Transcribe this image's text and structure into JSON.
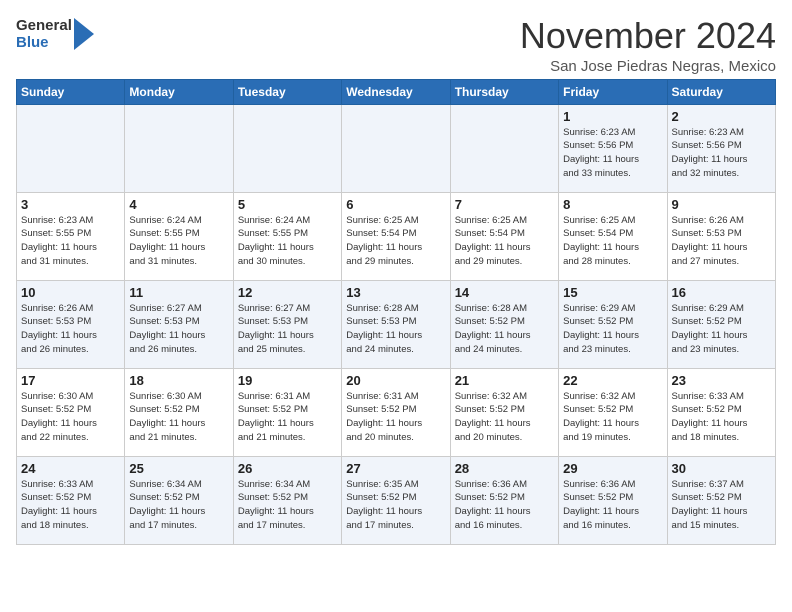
{
  "logo": {
    "general": "General",
    "blue": "Blue"
  },
  "header": {
    "month": "November 2024",
    "location": "San Jose Piedras Negras, Mexico"
  },
  "days_of_week": [
    "Sunday",
    "Monday",
    "Tuesday",
    "Wednesday",
    "Thursday",
    "Friday",
    "Saturday"
  ],
  "weeks": [
    [
      {
        "day": "",
        "info": ""
      },
      {
        "day": "",
        "info": ""
      },
      {
        "day": "",
        "info": ""
      },
      {
        "day": "",
        "info": ""
      },
      {
        "day": "",
        "info": ""
      },
      {
        "day": "1",
        "info": "Sunrise: 6:23 AM\nSunset: 5:56 PM\nDaylight: 11 hours\nand 33 minutes."
      },
      {
        "day": "2",
        "info": "Sunrise: 6:23 AM\nSunset: 5:56 PM\nDaylight: 11 hours\nand 32 minutes."
      }
    ],
    [
      {
        "day": "3",
        "info": "Sunrise: 6:23 AM\nSunset: 5:55 PM\nDaylight: 11 hours\nand 31 minutes."
      },
      {
        "day": "4",
        "info": "Sunrise: 6:24 AM\nSunset: 5:55 PM\nDaylight: 11 hours\nand 31 minutes."
      },
      {
        "day": "5",
        "info": "Sunrise: 6:24 AM\nSunset: 5:55 PM\nDaylight: 11 hours\nand 30 minutes."
      },
      {
        "day": "6",
        "info": "Sunrise: 6:25 AM\nSunset: 5:54 PM\nDaylight: 11 hours\nand 29 minutes."
      },
      {
        "day": "7",
        "info": "Sunrise: 6:25 AM\nSunset: 5:54 PM\nDaylight: 11 hours\nand 29 minutes."
      },
      {
        "day": "8",
        "info": "Sunrise: 6:25 AM\nSunset: 5:54 PM\nDaylight: 11 hours\nand 28 minutes."
      },
      {
        "day": "9",
        "info": "Sunrise: 6:26 AM\nSunset: 5:53 PM\nDaylight: 11 hours\nand 27 minutes."
      }
    ],
    [
      {
        "day": "10",
        "info": "Sunrise: 6:26 AM\nSunset: 5:53 PM\nDaylight: 11 hours\nand 26 minutes."
      },
      {
        "day": "11",
        "info": "Sunrise: 6:27 AM\nSunset: 5:53 PM\nDaylight: 11 hours\nand 26 minutes."
      },
      {
        "day": "12",
        "info": "Sunrise: 6:27 AM\nSunset: 5:53 PM\nDaylight: 11 hours\nand 25 minutes."
      },
      {
        "day": "13",
        "info": "Sunrise: 6:28 AM\nSunset: 5:53 PM\nDaylight: 11 hours\nand 24 minutes."
      },
      {
        "day": "14",
        "info": "Sunrise: 6:28 AM\nSunset: 5:52 PM\nDaylight: 11 hours\nand 24 minutes."
      },
      {
        "day": "15",
        "info": "Sunrise: 6:29 AM\nSunset: 5:52 PM\nDaylight: 11 hours\nand 23 minutes."
      },
      {
        "day": "16",
        "info": "Sunrise: 6:29 AM\nSunset: 5:52 PM\nDaylight: 11 hours\nand 23 minutes."
      }
    ],
    [
      {
        "day": "17",
        "info": "Sunrise: 6:30 AM\nSunset: 5:52 PM\nDaylight: 11 hours\nand 22 minutes."
      },
      {
        "day": "18",
        "info": "Sunrise: 6:30 AM\nSunset: 5:52 PM\nDaylight: 11 hours\nand 21 minutes."
      },
      {
        "day": "19",
        "info": "Sunrise: 6:31 AM\nSunset: 5:52 PM\nDaylight: 11 hours\nand 21 minutes."
      },
      {
        "day": "20",
        "info": "Sunrise: 6:31 AM\nSunset: 5:52 PM\nDaylight: 11 hours\nand 20 minutes."
      },
      {
        "day": "21",
        "info": "Sunrise: 6:32 AM\nSunset: 5:52 PM\nDaylight: 11 hours\nand 20 minutes."
      },
      {
        "day": "22",
        "info": "Sunrise: 6:32 AM\nSunset: 5:52 PM\nDaylight: 11 hours\nand 19 minutes."
      },
      {
        "day": "23",
        "info": "Sunrise: 6:33 AM\nSunset: 5:52 PM\nDaylight: 11 hours\nand 18 minutes."
      }
    ],
    [
      {
        "day": "24",
        "info": "Sunrise: 6:33 AM\nSunset: 5:52 PM\nDaylight: 11 hours\nand 18 minutes."
      },
      {
        "day": "25",
        "info": "Sunrise: 6:34 AM\nSunset: 5:52 PM\nDaylight: 11 hours\nand 17 minutes."
      },
      {
        "day": "26",
        "info": "Sunrise: 6:34 AM\nSunset: 5:52 PM\nDaylight: 11 hours\nand 17 minutes."
      },
      {
        "day": "27",
        "info": "Sunrise: 6:35 AM\nSunset: 5:52 PM\nDaylight: 11 hours\nand 17 minutes."
      },
      {
        "day": "28",
        "info": "Sunrise: 6:36 AM\nSunset: 5:52 PM\nDaylight: 11 hours\nand 16 minutes."
      },
      {
        "day": "29",
        "info": "Sunrise: 6:36 AM\nSunset: 5:52 PM\nDaylight: 11 hours\nand 16 minutes."
      },
      {
        "day": "30",
        "info": "Sunrise: 6:37 AM\nSunset: 5:52 PM\nDaylight: 11 hours\nand 15 minutes."
      }
    ]
  ]
}
